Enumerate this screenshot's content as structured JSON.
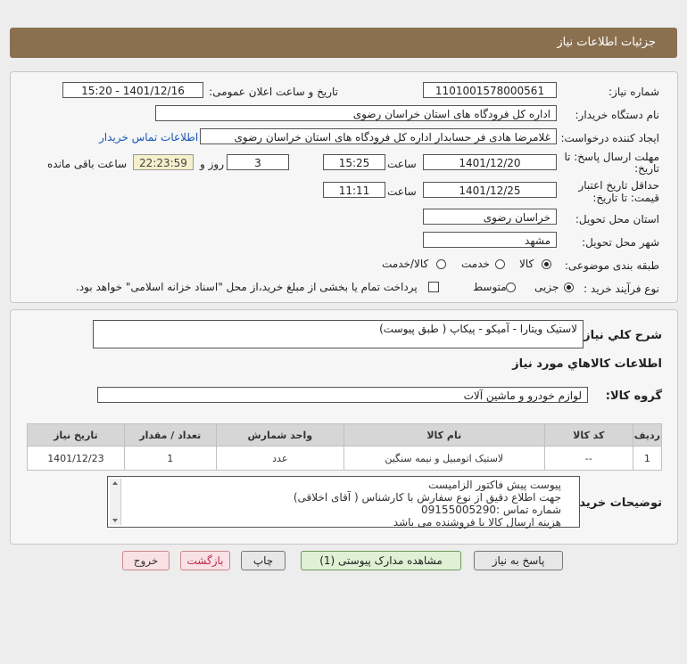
{
  "header": {
    "title": "جزئیات اطلاعات نیاز"
  },
  "form": {
    "need_number_label": "شماره نیاز:",
    "need_number": "1101001578000561",
    "announce_label": "تاریخ و ساعت اعلان عمومی:",
    "announce_value": "1401/12/16 - 15:20",
    "buyer_org_label": "نام دستگاه خریدار:",
    "buyer_org": "اداره کل فرودگاه های استان خراسان رضوی",
    "requester_label": "ایجاد کننده درخواست:",
    "requester": "غلامرضا هادی فر حسابدار اداره کل فرودگاه های استان خراسان رضوی",
    "contact_link": "اطلاعات تماس خریدار",
    "deadline_label_1": "مهلت ارسال پاسخ: تا",
    "deadline_label_2": "تاریخ:",
    "deadline_date": "1401/12/20",
    "time_label": "ساعت",
    "deadline_time": "15:25",
    "days_value": "3",
    "days_label": "روز و",
    "remaining_time": "22:23:59",
    "remaining_label": "ساعت باقی مانده",
    "validity_label_1": "حداقل تاریخ اعتبار",
    "validity_label_2": "قیمت: تا تاریخ:",
    "validity_date": "1401/12/25",
    "validity_time": "11:11",
    "province_label": "استان محل تحویل:",
    "province": "خراسان رضوی",
    "city_label": "شهر محل تحویل:",
    "city": "مشهد",
    "category_label": "طبقه بندی موضوعی:",
    "category_options": [
      "کالا",
      "خدمت",
      "کالا/خدمت"
    ],
    "category_selected": "کالا",
    "process_label": "نوع فرآیند خرید :",
    "process_options": [
      "جزیی",
      "متوسط"
    ],
    "process_selected": "جزیی",
    "payment_note": "پرداخت تمام یا بخشی از مبلغ خرید،از محل \"اسناد خزانه اسلامی\" خواهد بود."
  },
  "details": {
    "summary_label": "شرح کلي نياز:",
    "summary": "لاستیک ویتارا - آمیکو - پیکاپ ( طبق پیوست)",
    "items_heading": "اطلاعات کالاهاي مورد نياز",
    "group_label": "گروه کالا:",
    "group": "لوازم خودرو و ماشین آلات",
    "table": {
      "headers": [
        "ردیف",
        "کد کالا",
        "نام کالا",
        "واحد شمارش",
        "تعداد / مقدار",
        "تاریخ نیاز"
      ],
      "rows": [
        [
          "1",
          "--",
          "لاستیک اتومبیل و نیمه سنگین",
          "عدد",
          "1",
          "1401/12/23"
        ]
      ]
    },
    "notes_label": "توضیحات خریدار:",
    "notes": [
      "پیوست پیش فاکتور الزامیست",
      "جهت اطلاع دقیق از نوع سفارش با کارشناس  ( آقای اخلاقی)",
      "شماره تماس :09155005290",
      "هزینه ارسال کالا با فروشنده می باشد"
    ]
  },
  "buttons": {
    "reply": "پاسخ به نیاز",
    "attachments": "مشاهده مدارک پیوستی (1)",
    "print": "چاپ",
    "back": "بازگشت",
    "exit": "خروج"
  }
}
